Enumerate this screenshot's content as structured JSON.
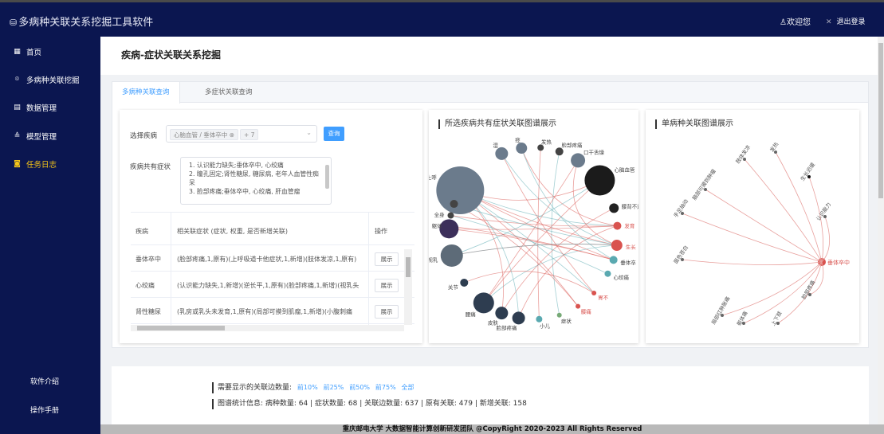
{
  "app": {
    "logo_glyph": "⛁",
    "title": "多病种关联关系挖掘工具软件",
    "welcome": "欢迎您",
    "logout": "退出登录"
  },
  "sidebar": {
    "items": [
      {
        "label": "首页",
        "icon": "grid-icon"
      },
      {
        "label": "多病种关联挖掘",
        "icon": "location-pin-icon"
      },
      {
        "label": "数据管理",
        "icon": "document-icon"
      },
      {
        "label": "模型管理",
        "icon": "layers-icon"
      },
      {
        "label": "任务日志",
        "icon": "camera-icon"
      }
    ],
    "bottom": [
      "软件介绍",
      "操作手册"
    ],
    "active_color": "#f5c518"
  },
  "page": {
    "title": "疾病-症状关联关系挖掘"
  },
  "tabs": [
    "多病种关联查询",
    "多症状关联查询"
  ],
  "query": {
    "select_label": "选择疾病",
    "chip1": "心脑血管 / 垂体卒中",
    "chip2": "+ 7",
    "query_button": "查询",
    "symptom_label": "疾病共有症状",
    "symptoms": [
      "1. 认识能力缺失;垂体卒中, 心绞痛",
      "2. 瞳孔固定;肾性糖尿, 糖尿病, 老年人血管性痴呆",
      "3. 脸部疼痛;垂体卒中, 心绞痛, 肝血管瘤"
    ]
  },
  "table": {
    "headers": [
      "疾病",
      "相关联症状 (症状, 权重, 是否新增关联)",
      "操作"
    ],
    "rows": [
      {
        "disease": "垂体卒中",
        "symptoms": "(脸部疼痛,1,原有)(上呼吸道卡他症状,1,新增)(肢体发凉,1,原有)",
        "action": "展示"
      },
      {
        "disease": "心绞痛",
        "symptoms": "(认识能力缺失,1,新增)(逆长平,1,原有)(脸部疼痛,1,新增)(视乳头",
        "action": "展示"
      },
      {
        "disease": "肾性糖尿",
        "symptoms": "(乳房或乳头未发育,1,原有)(局部可摸到肌瘤,1,新增)(小腹刺痛",
        "action": "展示"
      }
    ]
  },
  "charts": {
    "co_title": "所选疾病共有症状关联图谱展示",
    "single_title": "单病种关联图谱展示",
    "co_labels": [
      "上呼",
      "湿",
      "痉",
      "发热",
      "脸部疼痛",
      "口干舌燥",
      "心脑血管",
      "腰背不适",
      "发育",
      "生长",
      "垂体卒",
      "心绞痛",
      "胃不",
      "腰痛",
      "症状",
      "小儿",
      "脸部疼痛",
      "皮肤",
      "腰痛",
      "关节",
      "视乳",
      "躯体",
      "全身"
    ],
    "single_target": "垂体卒中",
    "single_labels": [
      "脑部可摸到肿瘤",
      "肢体发凉",
      "发热",
      "生长迟缓",
      "认识能力",
      "手足抽动",
      "面色苍白",
      "局部红肿胀痛",
      "躯体痛",
      "上下肢",
      "脸部疼痛"
    ]
  },
  "stats": {
    "line1_label": "需要显示的关联边数量:",
    "percents": [
      "前10%",
      "前25%",
      "前50%",
      "前75%",
      "全部"
    ],
    "line2": "图谱统计信息: 病种数量: 64 | 症状数量: 68 | 关联边数量: 637 | 原有关联: 479 | 新增关联: 158"
  },
  "footer": "重庆邮电大学 大数据智能计算创新研发团队 @CopyRight 2020-2023 All Rights Reserved",
  "colors": {
    "nav_bg": "#0b1650",
    "accent": "#409eff",
    "edge_red": "#d9534f",
    "edge_teal": "#5aa9b0"
  }
}
